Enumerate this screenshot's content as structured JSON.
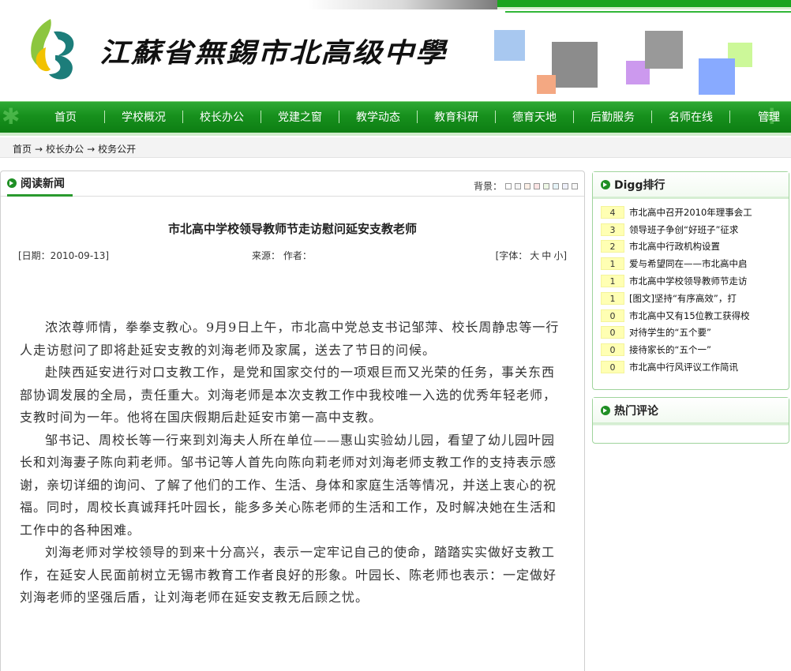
{
  "header": {
    "school_name": "江蘇省無錫市北高级中學",
    "logo_icon": "butterfly-b-logo",
    "accent_green": "#1aa51f",
    "decor_colors": [
      "#a8c8f0",
      "#8c8c8c",
      "#f4a882",
      "#cc99ee",
      "#999999",
      "#ccf899",
      "#88aaff"
    ]
  },
  "nav": {
    "items": [
      "首页",
      "学校概况",
      "校长办公",
      "党建之窗",
      "教学动态",
      "教育科研",
      "德育天地",
      "后勤服务",
      "名师在线",
      "管理"
    ]
  },
  "breadcrumb": {
    "items": [
      "首页",
      "校长办公",
      "校务公开"
    ],
    "separator": "→"
  },
  "main": {
    "tab_label": "阅读新闻",
    "bg_label": "背景：",
    "bg_colors": [
      "#ffffff",
      "#f5f5f5",
      "#fcefe6",
      "#fce4e4",
      "#eef8e6",
      "#e6f4f8",
      "#eef0fa",
      "#f8f8f8"
    ],
    "article": {
      "title": "市北高中学校领导教师节走访慰问延安支教老师",
      "date": "[日期：2010-09-13]",
      "source": "来源：  作者：",
      "font_label": "[字体：",
      "font_large": "大",
      "font_medium": "中",
      "font_small": "小]",
      "paragraphs": [
        "浓浓尊师情，拳拳支教心。9月9日上午，市北高中党总支书记邹萍、校长周静忠等一行人走访慰问了即将赴延安支教的刘海老师及家属，送去了节日的问候。",
        "赴陕西延安进行对口支教工作，是党和国家交付的一项艰巨而又光荣的任务，事关东西部协调发展的全局，责任重大。刘海老师是本次支教工作中我校唯一入选的优秀年轻老师，支教时间为一年。他将在国庆假期后赴延安市第一高中支教。",
        "邹书记、周校长等一行来到刘海夫人所在单位——惠山实验幼儿园，看望了幼儿园叶园长和刘海妻子陈向莉老师。邹书记等人首先向陈向莉老师对刘海老师支教工作的支持表示感谢，亲切详细的询问、了解了他们的工作、生活、身体和家庭生活等情况，并送上衷心的祝福。同时，周校长真诚拜托叶园长，能多多关心陈老师的生活和工作，及时解决她在生活和工作中的各种困难。",
        "刘海老师对学校领导的到来十分高兴，表示一定牢记自己的使命，踏踏实实做好支教工作，在延安人民面前树立无锡市教育工作者良好的形象。叶园长、陈老师也表示：一定做好刘海老师的坚强后盾，让刘海老师在延安支教无后顾之忧。"
      ]
    }
  },
  "digg": {
    "title": "Digg排行",
    "items": [
      {
        "count": "4",
        "title": "市北高中召开2010年理事会工"
      },
      {
        "count": "3",
        "title": "领导班子争创“好班子”征求"
      },
      {
        "count": "2",
        "title": "市北高中行政机构设置"
      },
      {
        "count": "1",
        "title": "爱与希望同在——市北高中启"
      },
      {
        "count": "1",
        "title": "市北高中学校领导教师节走访"
      },
      {
        "count": "1",
        "title": "[图文]坚持“有序高效”，打"
      },
      {
        "count": "0",
        "title": "市北高中又有15位教工获得校"
      },
      {
        "count": "0",
        "title": "对待学生的“五个要”"
      },
      {
        "count": "0",
        "title": "接待家长的“五个一”"
      },
      {
        "count": "0",
        "title": "市北高中行风评议工作简讯"
      }
    ]
  },
  "hot_comments": {
    "title": "热门评论"
  }
}
